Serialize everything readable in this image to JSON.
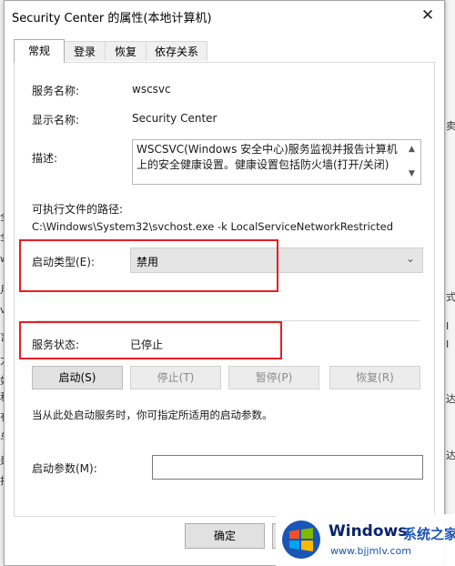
{
  "background": {
    "left_chars": [
      "全",
      "全",
      "w",
      "月",
      "v",
      "言",
      "力",
      "如",
      "和",
      "有",
      "与",
      "是",
      "打"
    ],
    "right_chars": [
      "卖",
      "式",
      "I",
      "I",
      "达",
      "达"
    ]
  },
  "dialog": {
    "title": "Security Center 的属性(本地计算机)",
    "close_glyph": "✕",
    "tabs": [
      "常规",
      "登录",
      "恢复",
      "依存关系"
    ]
  },
  "general": {
    "service_name_label": "服务名称:",
    "service_name_value": "wscsvc",
    "display_name_label": "显示名称:",
    "display_name_value": "Security Center",
    "description_label": "描述:",
    "description_value": "WSCSVC(Windows 安全中心)服务监视并报告计算机上的安全健康设置。健康设置包括防火墙(打开/关闭)",
    "exe_path_label": "可执行文件的路径:",
    "exe_path_value": "C:\\Windows\\System32\\svchost.exe -k LocalServiceNetworkRestricted",
    "startup_type_label": "启动类型(E):",
    "startup_type_value": "禁用",
    "service_status_label": "服务状态:",
    "service_status_value": "已停止",
    "buttons": {
      "start": "启动(S)",
      "stop": "停止(T)",
      "pause": "暂停(P)",
      "resume": "恢复(R)"
    },
    "hint": "当从此处启动服务时，你可指定所适用的启动参数。",
    "start_params_label": "启动参数(M):",
    "start_params_value": ""
  },
  "footer": {
    "ok": "确定",
    "cancel": ""
  },
  "watermark": {
    "brand": "Windows",
    "suffix": "系统之家",
    "url": "www.bjjmlv.com"
  },
  "colors": {
    "highlight_red": "#e81e24",
    "watermark_blue": "#1a55b8"
  }
}
